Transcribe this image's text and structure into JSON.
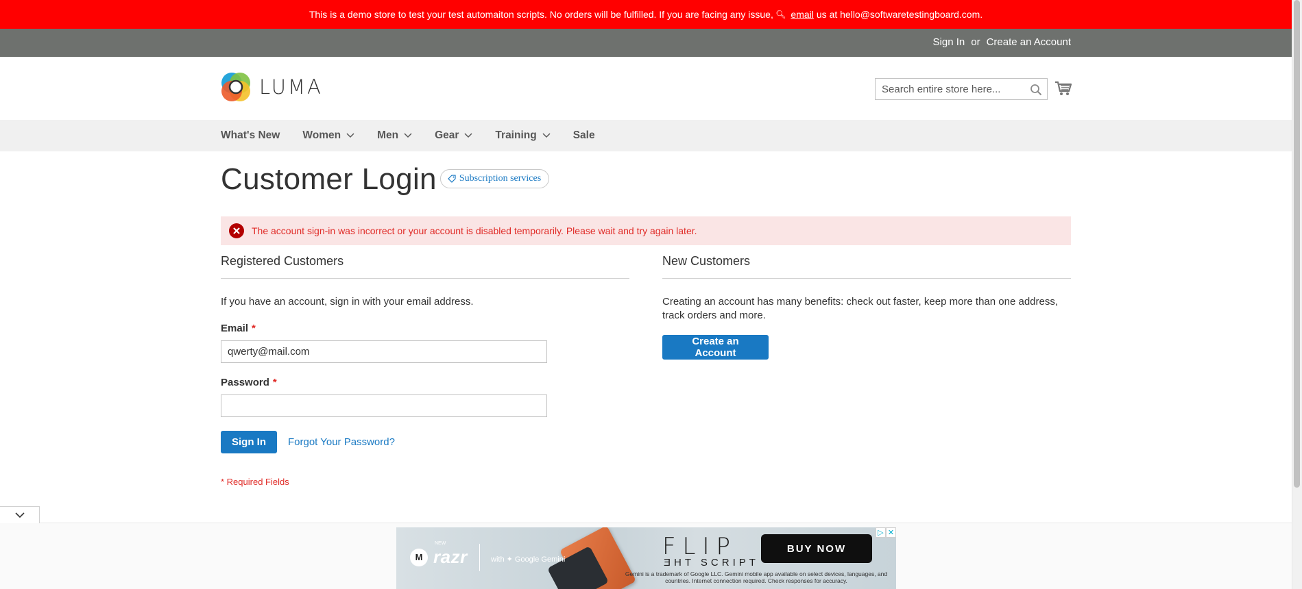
{
  "notice": {
    "text_before": "This is a demo store to test your test automaiton scripts. No orders will be fulfilled. If you are facing any issue,",
    "email_link": "email",
    "text_after": "us at hello@softwaretestingboard.com."
  },
  "panel": {
    "sign_in": "Sign In",
    "or": "or",
    "create_account": "Create an Account"
  },
  "header": {
    "logo_text": "LUMA",
    "search_placeholder": "Search entire store here..."
  },
  "nav": {
    "items": [
      {
        "label": "What's New",
        "has_dropdown": false
      },
      {
        "label": "Women",
        "has_dropdown": true
      },
      {
        "label": "Men",
        "has_dropdown": true
      },
      {
        "label": "Gear",
        "has_dropdown": true
      },
      {
        "label": "Training",
        "has_dropdown": true
      },
      {
        "label": "Sale",
        "has_dropdown": false
      }
    ]
  },
  "main": {
    "title": "Customer Login",
    "badge": "Subscription services",
    "error": "The account sign-in was incorrect or your account is disabled temporarily. Please wait and try again later.",
    "registered": {
      "title": "Registered Customers",
      "intro": "If you have an account, sign in with your email address.",
      "email_label": "Email",
      "email_value": "qwerty@mail.com",
      "password_label": "Password",
      "password_value": "",
      "required_mark": "*",
      "sign_in_button": "Sign In",
      "forgot_link": "Forgot Your Password?",
      "required_note": "* Required Fields"
    },
    "new_customers": {
      "title": "New Customers",
      "text": "Creating an account has many benefits: check out faster, keep more than one address, track orders and more.",
      "button": "Create an Account"
    }
  },
  "ad": {
    "razr_new": "NEW",
    "razr": "razr",
    "gemini": "with ✦ Google Gemini",
    "flip": "FLIP",
    "script": "ƎHT SCRIPT",
    "buy_now": "BUY NOW",
    "fine_print": "Gemini is a trademark of Google LLC. Gemini mobile app available on select devices, languages, and countries. Internet connection required. Check responses for accuracy."
  },
  "colors": {
    "demo_bar": "#ff0000",
    "panel_bg": "#6e716e",
    "nav_bg": "#f0f0f0",
    "primary": "#1979c3",
    "error_bg": "#fae5e5",
    "error_text": "#e02b27"
  }
}
